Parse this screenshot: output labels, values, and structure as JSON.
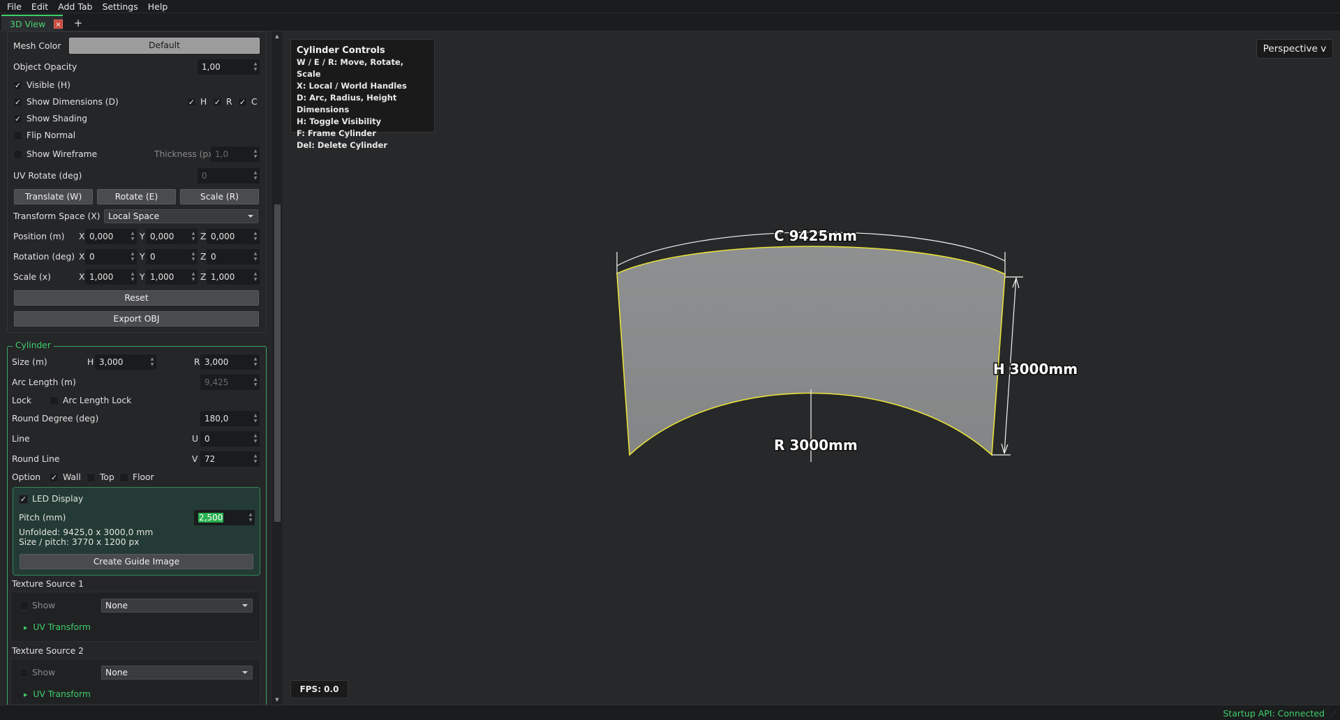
{
  "menubar": {
    "items": [
      "File",
      "Edit",
      "Add Tab",
      "Settings",
      "Help"
    ]
  },
  "tabs": {
    "active_label": "3D View",
    "close_glyph": "×",
    "add_glyph": "+"
  },
  "panel": {
    "mesh_color_label": "Mesh Color",
    "mesh_color_button": "Default",
    "object_opacity_label": "Object Opacity",
    "object_opacity_value": "1,00",
    "visible_label": "Visible (H)",
    "visible_checked": true,
    "show_dimensions_label": "Show Dimensions (D)",
    "show_dimensions_checked": true,
    "dim_h_label": "H",
    "dim_r_label": "R",
    "dim_c_label": "C",
    "show_shading_label": "Show Shading",
    "show_shading_checked": true,
    "flip_normal_label": "Flip Normal",
    "flip_normal_checked": false,
    "show_wireframe_label": "Show Wireframe",
    "show_wireframe_checked": false,
    "thickness_label": "Thickness (px)",
    "thickness_value": "1,0",
    "uv_rotate_label": "UV Rotate (deg)",
    "uv_rotate_value": "0",
    "translate_button": "Translate (W)",
    "rotate_button": "Rotate (E)",
    "scale_button": "Scale (R)",
    "transform_space_label": "Transform Space (X)",
    "transform_space_value": "Local Space",
    "position_label": "Position (m)",
    "position": {
      "x": "0,000",
      "y": "0,000",
      "z": "0,000"
    },
    "rotation_label": "Rotation (deg)",
    "rotation": {
      "x": "0",
      "y": "0",
      "z": "0"
    },
    "scale_label": "Scale (x)",
    "scale": {
      "x": "1,000",
      "y": "1,000",
      "z": "1,000"
    },
    "axis_x": "X",
    "axis_y": "Y",
    "axis_z": "Z",
    "reset_button": "Reset",
    "export_button": "Export OBJ"
  },
  "cylinder": {
    "title": "Cylinder",
    "size_label": "Size (m)",
    "h_label": "H",
    "h_value": "3,000",
    "r_label": "R",
    "r_value": "3,000",
    "arc_length_label": "Arc Length (m)",
    "arc_length_value": "9,425",
    "lock_label": "Lock",
    "arc_length_lock_label": "Arc Length Lock",
    "arc_length_lock_checked": false,
    "round_degree_label": "Round Degree (deg)",
    "round_degree_value": "180,0",
    "line_label": "Line",
    "u_label": "U",
    "u_value": "0",
    "round_line_label": "Round Line",
    "v_label": "V",
    "v_value": "72",
    "option_label": "Option",
    "wall_label": "Wall",
    "wall_checked": true,
    "top_label": "Top",
    "top_checked": false,
    "floor_label": "Floor",
    "floor_checked": false,
    "led_display_label": "LED Display",
    "led_display_checked": true,
    "pitch_label": "Pitch (mm)",
    "pitch_value": "2,500",
    "unfolded_text": "Unfolded: 9425,0 x 3000,0 mm",
    "size_pitch_text": "Size / pitch: 3770 x 1200 px",
    "create_guide_button": "Create Guide Image",
    "texture_sources": [
      {
        "title": "Texture Source 1",
        "show_label": "Show",
        "show_checked": false,
        "source_value": "None",
        "uv_transform_label": "UV Transform"
      },
      {
        "title": "Texture Source 2",
        "show_label": "Show",
        "show_checked": false,
        "source_value": "None",
        "uv_transform_label": "UV Transform"
      }
    ]
  },
  "viewport": {
    "controls_title": "Cylinder Controls",
    "controls_lines": [
      "W / E / R: Move, Rotate, Scale",
      "X: Local / World Handles",
      "D: Arc, Radius, Height Dimensions",
      "H: Toggle Visibility",
      "F: Frame Cylinder",
      "Del: Delete Cylinder"
    ],
    "perspective_button": "Perspective v",
    "fps_text": "FPS: 0.0",
    "dimension_c": "C 9425mm",
    "dimension_h": "H 3000mm",
    "dimension_r": "R 3000mm",
    "mesh_color": "#8a8c8d",
    "outline_color": "#e8e23a"
  },
  "status": {
    "text": "Startup API: Connected"
  },
  "colors": {
    "accent": "#3ecf6a",
    "close": "#c84a3e",
    "selection": "#28b04e"
  }
}
